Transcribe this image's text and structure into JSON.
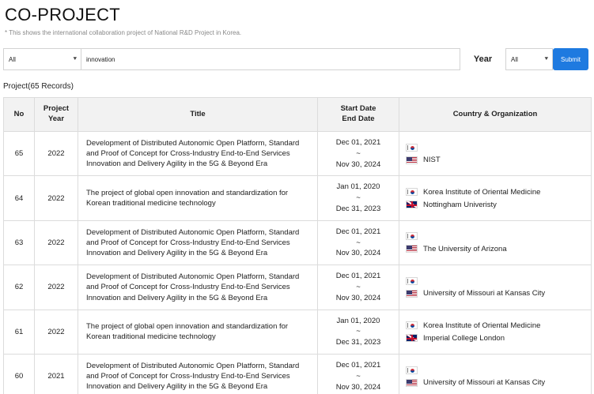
{
  "page": {
    "title": "CO-PROJECT",
    "subtitle": "* This shows the international collaboration project of National R&D Project in Korea."
  },
  "search": {
    "category_value": "All",
    "query_value": "innovation",
    "year_label": "Year",
    "year_value": "All",
    "submit_label": "Submit"
  },
  "records": {
    "label": "Project(65 Records)"
  },
  "table": {
    "headers": {
      "no": "No",
      "year": "Project\nYear",
      "title": "Title",
      "dates": "Start Date\nEnd Date",
      "country": "Country & Organization"
    },
    "rows": [
      {
        "no": "65",
        "year": "2022",
        "title": "Development of Distributed Autonomic Open Platform, Standard and Proof of Concept for Cross-Industry End-to-End Services Innovation and Delivery Agility in the 5G & Beyond Era",
        "start": "Dec 01, 2021",
        "sep": "~",
        "end": "Nov 30, 2024",
        "orgs": [
          {
            "flag": "kr-flag-icon",
            "name": ""
          },
          {
            "flag": "us-flag-icon",
            "name": "NIST"
          }
        ]
      },
      {
        "no": "64",
        "year": "2022",
        "title": "The project of global open innovation and standardization for Korean traditional medicine technology",
        "start": "Jan 01, 2020",
        "sep": "~",
        "end": "Dec 31, 2023",
        "orgs": [
          {
            "flag": "kr-flag-icon",
            "name": "Korea Institute of Oriental Medicine"
          },
          {
            "flag": "uk-flag-icon",
            "name": "Nottingham Univeristy"
          }
        ]
      },
      {
        "no": "63",
        "year": "2022",
        "title": "Development of Distributed Autonomic Open Platform, Standard and Proof of Concept for Cross-Industry End-to-End Services Innovation and Delivery Agility in the 5G & Beyond Era",
        "start": "Dec 01, 2021",
        "sep": "~",
        "end": "Nov 30, 2024",
        "orgs": [
          {
            "flag": "kr-flag-icon",
            "name": ""
          },
          {
            "flag": "us-flag-icon",
            "name": "The University of Arizona"
          }
        ]
      },
      {
        "no": "62",
        "year": "2022",
        "title": "Development of Distributed Autonomic Open Platform, Standard and Proof of Concept for Cross-Industry End-to-End Services Innovation and Delivery Agility in the 5G & Beyond Era",
        "start": "Dec 01, 2021",
        "sep": "~",
        "end": "Nov 30, 2024",
        "orgs": [
          {
            "flag": "kr-flag-icon",
            "name": ""
          },
          {
            "flag": "us-flag-icon",
            "name": "University of Missouri at Kansas City"
          }
        ]
      },
      {
        "no": "61",
        "year": "2022",
        "title": "The project of global open innovation and standardization for Korean traditional medicine technology",
        "start": "Jan 01, 2020",
        "sep": "~",
        "end": "Dec 31, 2023",
        "orgs": [
          {
            "flag": "kr-flag-icon",
            "name": "Korea Institute of Oriental Medicine"
          },
          {
            "flag": "uk-flag-icon",
            "name": "Imperial College London"
          }
        ]
      },
      {
        "no": "60",
        "year": "2021",
        "title": "Development of Distributed Autonomic Open Platform, Standard and Proof of Concept for Cross-Industry End-to-End Services Innovation and Delivery Agility in the 5G & Beyond Era",
        "start": "Dec 01, 2021",
        "sep": "~",
        "end": "Nov 30, 2024",
        "orgs": [
          {
            "flag": "kr-flag-icon",
            "name": ""
          },
          {
            "flag": "us-flag-icon",
            "name": "University of Missouri at Kansas City"
          }
        ]
      }
    ]
  },
  "colors": {
    "accent": "#1e7ae0",
    "header_bg": "#f2f2f2",
    "border": "#dcdcdc"
  }
}
